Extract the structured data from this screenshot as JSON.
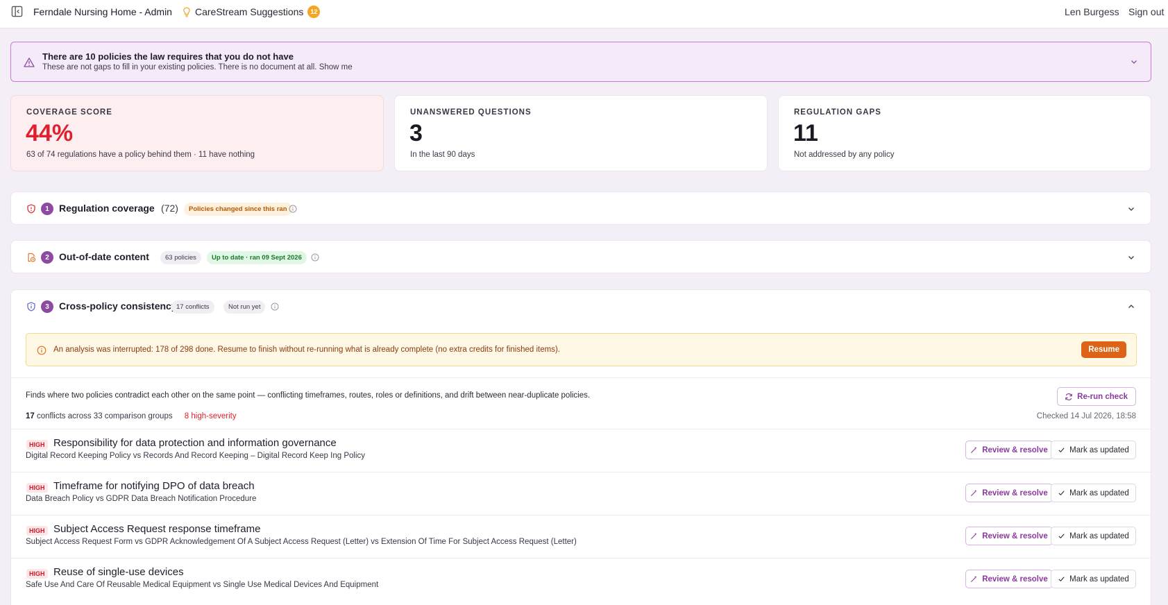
{
  "topbar": {
    "app_title": "Ferndale Nursing Home - Admin",
    "suggestions_label": "CareStream Suggestions",
    "suggestions_count": "12",
    "user_name": "Len Burgess",
    "sign_out": "Sign out"
  },
  "banner": {
    "title": "There are 10 policies the law requires that you do not have",
    "subtitle": "These are not gaps to fill in your existing policies. There is no document at all.",
    "show_me": "Show me"
  },
  "metrics": {
    "coverage": {
      "label": "COVERAGE SCORE",
      "value": "44%",
      "note": "63 of 74 regulations have a policy behind them · 11 have nothing"
    },
    "unanswered": {
      "label": "UNANSWERED QUESTIONS",
      "value": "3",
      "note": "In the last 90 days"
    },
    "gaps": {
      "label": "REGULATION GAPS",
      "value": "11",
      "note": "Not addressed by any policy"
    }
  },
  "sections": [
    {
      "number": "1",
      "title": "Regulation coverage",
      "count": "(72)",
      "pills": [
        "Policies changed since this ran"
      ]
    },
    {
      "number": "2",
      "title": "Out-of-date content",
      "pills": [
        "63 policies",
        "Up to date · ran 09 Sept 2026"
      ]
    },
    {
      "number": "3",
      "title": "Cross-policy consistency",
      "pills": [
        "17 conflicts",
        "Not run yet"
      ]
    }
  ],
  "consistency": {
    "interrupt_text": "An analysis was interrupted: 178 of 298 done. Resume to finish without re-running what is already complete (no extra credits for finished items).",
    "resume_label": "Resume",
    "description": "Finds where two policies contradict each other on the same point — conflicting timeframes, routes, roles or definitions, and drift between near-duplicate policies.",
    "rerun_label": "Re-run check",
    "summary_count": "17",
    "summary_rest": "conflicts across 33 comparison groups",
    "high_severity": "8 high-severity",
    "checked": "Checked 14 Jul 2026, 18:58",
    "review_label": "Review & resolve",
    "mark_label": "Mark as updated",
    "conflicts": [
      {
        "severity": "HIGH",
        "title": "Responsibility for data protection and information governance",
        "policies": "Digital Record Keeping Policy vs Records And Record Keeping – Digital Record Keep Ing Policy"
      },
      {
        "severity": "HIGH",
        "title": "Timeframe for notifying DPO of data breach",
        "policies": "Data Breach Policy vs GDPR Data Breach Notification Procedure"
      },
      {
        "severity": "HIGH",
        "title": "Subject Access Request response timeframe",
        "policies": "Subject Access Request Form vs GDPR Acknowledgement Of A Subject Access Request (Letter) vs Extension Of Time For Subject Access Request (Letter)"
      },
      {
        "severity": "HIGH",
        "title": "Reuse of single-use devices",
        "policies": "Safe Use And Care Of Reusable Medical Equipment vs Single Use Medical Devices And Equipment"
      }
    ]
  },
  "colors": {
    "accent": "#8c4aa3",
    "danger": "#e0202e",
    "resume": "#dd6316",
    "badge": "#f5a524"
  }
}
